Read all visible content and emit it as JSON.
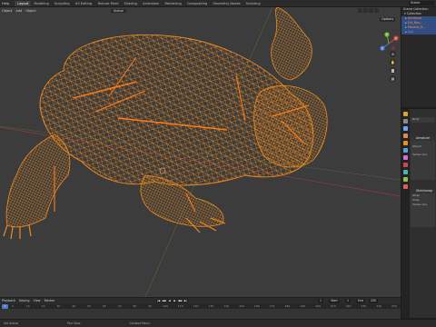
{
  "menu": [
    "Help"
  ],
  "workspace_tabs": [
    "Layout",
    "Modeling",
    "Sculpting",
    "UV Editing",
    "Texture Paint",
    "Shading",
    "Animation",
    "Rendering",
    "Compositing",
    "Geometry Nodes",
    "Scripting"
  ],
  "active_tab": "Layout",
  "scene_name": "Scene",
  "viewport": {
    "header_items": [
      "Object",
      "Add",
      "Object"
    ],
    "orientation": "Global",
    "options_label": "Options",
    "axis_labels": {
      "x": "X",
      "y": "Y",
      "z": "Z"
    },
    "wire_color": "#f08a1c",
    "background": "#3c3c3c"
  },
  "outliner": {
    "rows": [
      {
        "label": "Scene Collection",
        "icon": "collection-icon"
      },
      {
        "label": "Collection",
        "icon": "collection-icon"
      },
      {
        "label": "Armature",
        "icon": "armature-icon"
      },
      {
        "label": "Ext_Nov...",
        "icon": "mesh-icon"
      },
      {
        "label": "Marmot_B...",
        "icon": "mesh-icon"
      },
      {
        "label": "Sun",
        "icon": "light-icon"
      }
    ]
  },
  "properties": {
    "object_name": "Body",
    "panels": [
      {
        "title": "Armature",
        "lines": [
          "Object",
          "Vertex Gro"
        ]
      },
      {
        "title": "Shrinkwrap",
        "lines": [
          "Wrap",
          "Snap",
          "Vertex Gro"
        ]
      }
    ],
    "tab_colors": [
      "#d8a13a",
      "#8a8a8a",
      "#6aa7f0",
      "#e0895a",
      "#f08a1c",
      "#54a3e8",
      "#d66ad9",
      "#d04848",
      "#47b8b0",
      "#8ac550",
      "#e35a5a"
    ]
  },
  "timeline": {
    "header_items": [
      "Playback",
      "Keying",
      "View",
      "Marker"
    ],
    "current_frame": "1",
    "start_label": "Start",
    "start": "1",
    "end_label": "End",
    "end": "250",
    "ticks": [
      "0",
      "10",
      "20",
      "30",
      "40",
      "50",
      "60",
      "70",
      "80",
      "90",
      "100",
      "110",
      "120",
      "130",
      "140",
      "150",
      "160",
      "170",
      "180",
      "190",
      "200",
      "210",
      "220",
      "230",
      "240",
      "250"
    ],
    "playback_buttons": [
      "|◀",
      "◀◆",
      "◀",
      "▶",
      "◆▶",
      "▶|"
    ]
  },
  "statusbar": {
    "items": [
      "Set Active",
      "Pan View",
      "Context Menu"
    ]
  }
}
